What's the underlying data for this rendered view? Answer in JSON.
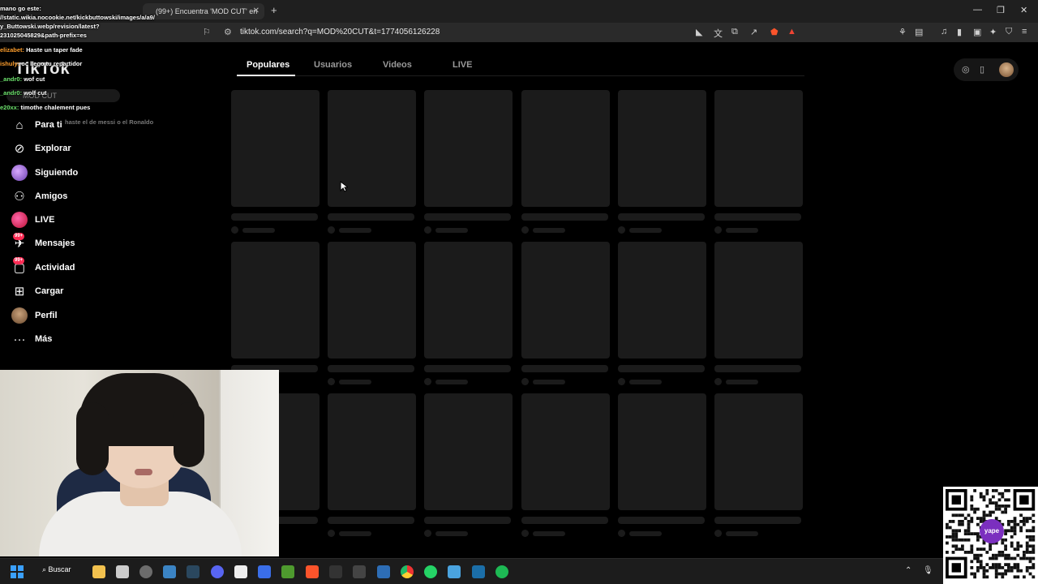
{
  "browser": {
    "tabs": [
      {
        "label": "(99+) Encuentra 'MOD CUT' en T...",
        "active": true
      }
    ],
    "url": "tiktok.com/search?q=MOD%20CUT&t=1774056126228",
    "chrome_icons": [
      "bookmark-icon",
      "site-info-icon"
    ],
    "extension_icons": [
      "reader-icon",
      "translate-icon",
      "screenshot-icon",
      "share-icon",
      "brave-shield-icon",
      "brave-rewards-icon",
      "extensions-icon",
      "sidebar-icon",
      "media-icon",
      "panel-icon",
      "wallet-icon",
      "leo-icon",
      "vpn-icon",
      "menu-icon"
    ]
  },
  "chat": [
    {
      "user": "",
      "text": "mano go este:",
      "color": "#fff"
    },
    {
      "user": "",
      "text": "//static.wikia.nocookie.net/kickbuttowski/images/a/a9/",
      "color": "#fff"
    },
    {
      "user": "",
      "text": "y_Buttowski.webp/revision/latest?",
      "color": "#fff"
    },
    {
      "user": "",
      "text": "231025045829&path-prefix=es",
      "color": "#fff"
    },
    {
      "user": "elizabet:",
      "text": "Haste un taper fade",
      "color": "#ff9f2d"
    },
    {
      "user": "ishuly:",
      "text": "oc llego tu repartidor",
      "color": "#ff9f2d"
    },
    {
      "user": "_andr0:",
      "text": "wof cut",
      "color": "#6de36d"
    },
    {
      "user": "_andr0:",
      "text": "wolf cut",
      "color": "#6de36d"
    },
    {
      "user": "e20xx:",
      "text": "timothe chalement pues",
      "color": "#6de36d"
    },
    {
      "user": "",
      "text": "haste el de messi o el Ronaldo",
      "color": "#777"
    }
  ],
  "tiktok": {
    "logo": "TikTok",
    "search_placeholder": "MOD CUT",
    "nav": [
      {
        "label": "Para ti",
        "icon": "home-icon"
      },
      {
        "label": "Explorar",
        "icon": "compass-icon"
      },
      {
        "label": "Siguiendo",
        "icon": "following-avatar-icon"
      },
      {
        "label": "Amigos",
        "icon": "friends-icon"
      },
      {
        "label": "LIVE",
        "icon": "live-icon"
      },
      {
        "label": "Mensajes",
        "icon": "messages-icon",
        "badge": "99+"
      },
      {
        "label": "Actividad",
        "icon": "activity-icon",
        "badge": "99+"
      },
      {
        "label": "Cargar",
        "icon": "upload-icon"
      },
      {
        "label": "Perfil",
        "icon": "profile-avatar-icon"
      },
      {
        "label": "Más",
        "icon": "more-icon"
      }
    ],
    "search_tabs": [
      {
        "label": "Populares",
        "active": true
      },
      {
        "label": "Usuarios",
        "active": false
      },
      {
        "label": "Videos",
        "active": false
      },
      {
        "label": "LIVE",
        "active": false
      }
    ],
    "top_right_icons": [
      "coin-icon",
      "phone-icon",
      "user-avatar-icon"
    ],
    "results_loading": true,
    "skeleton_rows": 3,
    "skeleton_cols": 6
  },
  "taskbar": {
    "search_label": "Buscar",
    "apps": [
      "file-explorer-icon",
      "store-icon",
      "apps-icon",
      "chat-icon",
      "steam-icon",
      "discord-icon",
      "capcut-icon",
      "blue-app-icon",
      "minecraft-icon",
      "brave-icon",
      "epic-games-icon",
      "obs-icon",
      "calculator-icon",
      "chrome-icon",
      "whatsapp-icon",
      "notepad-icon",
      "steam-icon",
      "spotify-icon"
    ],
    "tray": [
      "chevron-up-icon",
      "microphone-icon"
    ]
  },
  "overlay": {
    "qr_brand": "yape"
  },
  "colors": {
    "accent": "#fe2c55",
    "background": "#000000",
    "skeleton": "#1b1b1b"
  }
}
